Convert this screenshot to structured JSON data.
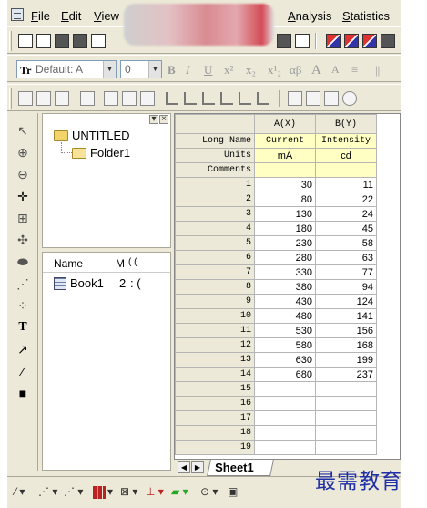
{
  "menu": {
    "file": "File",
    "edit": "Edit",
    "view": "View",
    "analysis": "Analysis",
    "statistics": "Statistics"
  },
  "format_toolbar": {
    "font": "Default: A",
    "size": "0",
    "bold": "B",
    "italic": "I",
    "underline": "U",
    "superscript": "x²",
    "subscript": "x₂",
    "supsub": "x¹₂",
    "greek": "αβ",
    "grow": "A",
    "shrink": "A"
  },
  "explorer": {
    "root": "UNTITLED",
    "folder": "Folder1",
    "columns": {
      "name": "Name",
      "m": "M",
      "c": "( ( "
    },
    "items": [
      {
        "name": "Book1",
        "m": "2",
        "c": ": ("
      }
    ]
  },
  "worksheet": {
    "columns": [
      "A(X)",
      "B(Y)"
    ],
    "meta_labels": {
      "long_name": "Long Name",
      "units": "Units",
      "comments": "Comments"
    },
    "long_names": [
      "Current",
      "Intensity"
    ],
    "units": [
      "mA",
      "cd"
    ],
    "rows": [
      [
        "1",
        "30",
        "11"
      ],
      [
        "2",
        "80",
        "22"
      ],
      [
        "3",
        "130",
        "24"
      ],
      [
        "4",
        "180",
        "45"
      ],
      [
        "5",
        "230",
        "58"
      ],
      [
        "6",
        "280",
        "63"
      ],
      [
        "7",
        "330",
        "77"
      ],
      [
        "8",
        "380",
        "94"
      ],
      [
        "9",
        "430",
        "124"
      ],
      [
        "10",
        "480",
        "141"
      ],
      [
        "11",
        "530",
        "156"
      ],
      [
        "12",
        "580",
        "168"
      ],
      [
        "13",
        "630",
        "199"
      ],
      [
        "14",
        "680",
        "237"
      ],
      [
        "15",
        "",
        ""
      ],
      [
        "16",
        "",
        ""
      ],
      [
        "17",
        "",
        ""
      ],
      [
        "18",
        "",
        ""
      ],
      [
        "19",
        "",
        ""
      ]
    ],
    "sheet_tab": "Sheet1"
  },
  "watermark": "最需教育"
}
